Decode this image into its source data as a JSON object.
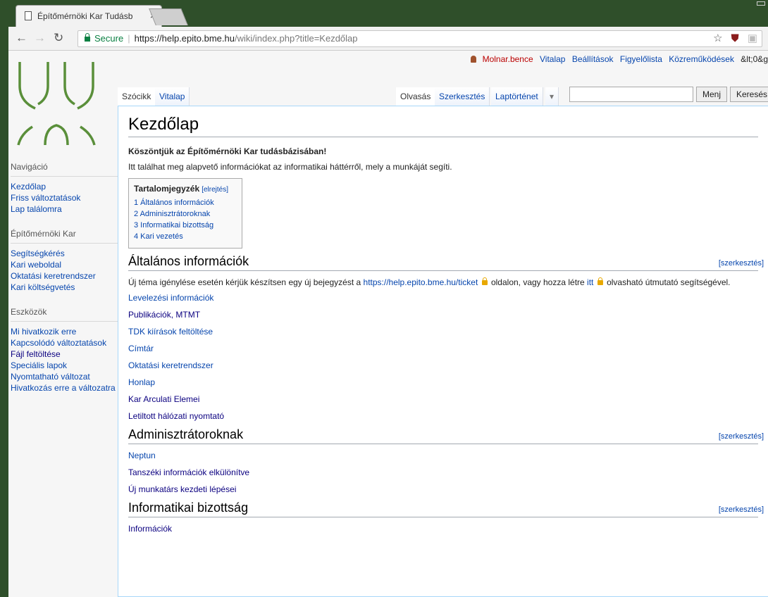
{
  "browser": {
    "tab_title": "Építőmérnöki Kar Tudásb",
    "tab_close": "×",
    "secure_label": "Secure",
    "url_scheme_host": "https://help.epito.bme.hu",
    "url_path": "/wiki/index.php?title=Kezdőlap",
    "icons": [
      "back-icon",
      "forward-icon",
      "reload-icon",
      "star-icon",
      "ublock-icon",
      "pdf-icon"
    ]
  },
  "personal": {
    "user": "Molnar.bence",
    "items": [
      "Vitalap",
      "Beállítások",
      "Figyelőlista",
      "Közreműködések",
      "&lt;0&g"
    ]
  },
  "tabs": {
    "left": [
      "Szócikk",
      "Vitalap"
    ],
    "right": [
      "Olvasás",
      "Szerkesztés",
      "Laptörténet"
    ],
    "more": "▾"
  },
  "search": {
    "value": "",
    "go": "Menj",
    "search": "Keresés"
  },
  "sidebar": {
    "sections": [
      {
        "heading": "Navigáció",
        "items": [
          "Kezdőlap",
          "Friss változtatások",
          "Lap találomra"
        ]
      },
      {
        "heading": "Építőmérnöki Kar",
        "items": [
          "Segítségkérés",
          "Kari weboldal",
          "Oktatási keretrendszer",
          "Kari költségvetés"
        ]
      },
      {
        "heading": "Eszközök",
        "items": [
          "Mi hivatkozik erre",
          "Kapcsolódó változtatások",
          "Fájl feltöltése",
          "Speciális lapok",
          "Nyomtatható változat",
          "Hivatkozás erre a változatra"
        ]
      }
    ]
  },
  "page": {
    "title": "Kezdőlap",
    "welcome": "Köszöntjük az Építőmérnöki Kar tudásbázisában!",
    "intro": "Itt találhat meg alapvető információkat az informatikai háttérről, mely a munkáját segíti.",
    "toc": {
      "title": "Tartalomjegyzék",
      "toggle": "[elrejtés]",
      "items": [
        "1 Általános információk",
        "2 Adminisztrátoroknak",
        "3 Informatikai bizottság",
        "4 Kari vezetés"
      ]
    },
    "edit_label": "[szerkesztés]",
    "sections": [
      {
        "title": "Általános információk",
        "text_before": "Új téma igénylése esetén kérjük készítsen egy új bejegyzést a ",
        "link_ticket": "https://help.epito.bme.hu/ticket",
        "text_middle": " oldalon, vagy hozza létre ",
        "link_itt": "itt",
        "text_after": " olvasható útmutató segítségével.",
        "links": [
          "Levelezési információk",
          "Publikációk, MTMT",
          "TDK kiírások feltöltése",
          "Címtár",
          "Oktatási keretrendszer",
          "Honlap",
          "Kar Arculati Elemei",
          "Letiltott hálózati nyomtató"
        ]
      },
      {
        "title": "Adminisztrátoroknak",
        "links": [
          "Neptun",
          "Tanszéki információk elkülönítve",
          "Új munkatárs kezdeti lépései"
        ]
      },
      {
        "title": "Informatikai bizottság",
        "links": [
          "Információk"
        ]
      }
    ]
  },
  "colors": {
    "link": "#0645ad",
    "visited": "#0b0080",
    "logo_green": "#5a8f3a",
    "user_red": "#ba0000",
    "secure_green": "#0b8043"
  }
}
